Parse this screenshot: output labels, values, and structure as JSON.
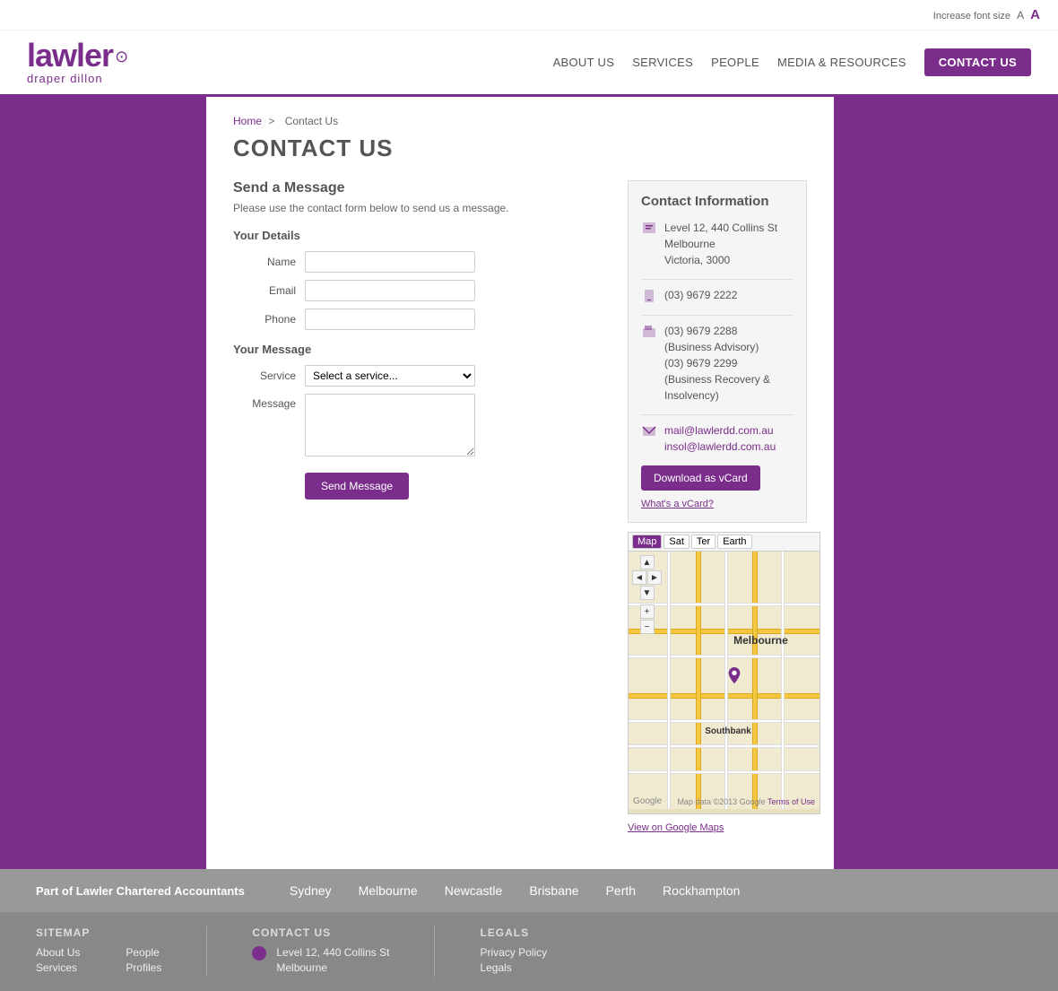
{
  "topbar": {
    "font_label": "Increase font size",
    "font_a_small": "A",
    "font_a_large": "A"
  },
  "header": {
    "logo_text": "lawler",
    "logo_sub": "draper dillon",
    "logo_symbol": "⊙",
    "nav": [
      {
        "id": "about",
        "label": "ABOUT US",
        "active": false
      },
      {
        "id": "services",
        "label": "SERVICES",
        "active": false
      },
      {
        "id": "people",
        "label": "PEOPLE",
        "active": false
      },
      {
        "id": "media",
        "label": "MEDIA & RESOURCES",
        "active": false
      },
      {
        "id": "contact",
        "label": "CONTACT US",
        "active": true
      }
    ]
  },
  "breadcrumb": {
    "home": "Home",
    "separator": ">",
    "current": "Contact Us"
  },
  "page": {
    "title": "CONTACT US"
  },
  "form": {
    "send_heading": "Send a Message",
    "send_desc": "Please use the contact form below to send us a message.",
    "your_details": "Your Details",
    "name_label": "Name",
    "email_label": "Email",
    "phone_label": "Phone",
    "your_message": "Your Message",
    "service_label": "Service",
    "message_label": "Message",
    "send_button": "Send Message",
    "service_options": [
      "Select a service..."
    ]
  },
  "contact_info": {
    "title": "Contact Information",
    "address_line1": "Level 12, 440 Collins St",
    "address_line2": "Melbourne",
    "address_line3": "Victoria, 3000",
    "phone1": "(03) 9679 2222",
    "phone2": "(03) 9679 2288",
    "phone2_desc1": "(Business Advisory)",
    "phone3": "(03) 9679 2299",
    "phone3_desc": "(Business Recovery & Insolvency)",
    "email1": "mail@lawlerdd.com.au",
    "email2": "insol@lawlerdd.com.au",
    "vcard_button": "Download as vCard",
    "vcard_link": "What's a vCard?"
  },
  "map": {
    "toolbar": {
      "map_btn": "Map",
      "sat_btn": "Sat",
      "ter_btn": "Ter",
      "earth_btn": "Earth"
    },
    "nav_buttons": [
      "◄",
      "+",
      "−",
      "►"
    ],
    "label_melbourne": "Melbourne",
    "label_southbank": "Southbank",
    "google_logo": "Google",
    "copyright": "Map data ©2013 Google",
    "terms": "Terms of Use",
    "view_link": "View on Google Maps"
  },
  "footer": {
    "part_of": "Part of Lawler Chartered Accountants",
    "cities": [
      "Sydney",
      "Melbourne",
      "Newcastle",
      "Brisbane",
      "Perth",
      "Rockhampton"
    ],
    "sitemap_title": "SITEMAP",
    "sitemap_links": [
      "About Us",
      "Services"
    ],
    "people_title": "",
    "people_links": [
      "People",
      "Profiles"
    ],
    "contact_title": "CONTACT US",
    "contact_address": "Level 12, 440 Collins St",
    "contact_city": "Melbourne",
    "legals_title": "LEGALS",
    "legals_links": [
      "Privacy Policy",
      "Legals"
    ]
  }
}
